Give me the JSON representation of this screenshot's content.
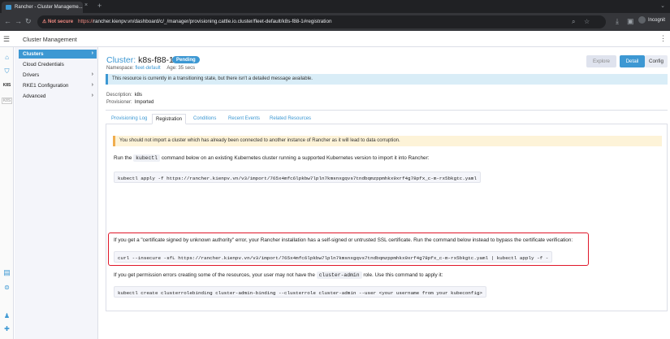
{
  "browser": {
    "tab_title": "Rancher - Cluster Manageme...",
    "tab_close": "×",
    "new_tab": "+",
    "tab_menu": "⌄",
    "not_secure": "Not secure",
    "url_scheme": "https://",
    "url_rest": "rancher.kienpv.vn/dashboard/c/_/manager/provisioning.cattle.io.cluster/fleet-default/k8s-f88-1#registration",
    "profile_label": "Incognit",
    "icons": [
      "back-arrow-icon",
      "forward-arrow-icon",
      "reload-icon",
      "zoom-icon",
      "star-icon",
      "download-icon"
    ]
  },
  "header": {
    "title": "Cluster Management"
  },
  "rail": {
    "k8s_label": "K8S",
    "k8s_dim_label": "K8S"
  },
  "sidebar": {
    "items": [
      {
        "label": "Clusters",
        "active": true,
        "chevron": "›"
      },
      {
        "label": "Cloud Credentials",
        "active": false,
        "chevron": ""
      },
      {
        "label": "Drivers",
        "active": false,
        "chevron": "›"
      },
      {
        "label": "RKE1 Configuration",
        "active": false,
        "chevron": "›"
      },
      {
        "label": "Advanced",
        "active": false,
        "chevron": "›"
      }
    ]
  },
  "cluster": {
    "label": "Cluster:",
    "name": "k8s-f88-1",
    "status": "Pending",
    "namespace_label": "Namespace:",
    "namespace": "fleet-default",
    "age": "Age: 35 secs",
    "buttons": {
      "explore": "Explore",
      "detail": "Detail",
      "config": "Config"
    },
    "transition_message": "This resource is currently in a transitioning state, but there isn't a detailed message available.",
    "description_label": "Description:",
    "description": "k8s",
    "provisioner_label": "Provisioner:",
    "provisioner": "Imported"
  },
  "tabs": [
    {
      "label": "Provisioning Log",
      "active": false
    },
    {
      "label": "Registration",
      "active": true
    },
    {
      "label": "Conditions",
      "active": false
    },
    {
      "label": "Recent Events",
      "active": false
    },
    {
      "label": "Related Resources",
      "active": false
    }
  ],
  "registration": {
    "warning": "You should not import a cluster which has already been connected to another instance of Rancher as it will lead to data corruption.",
    "run_prefix": "Run the",
    "run_kw": "kubectl",
    "run_suffix": "command below on an existing Kubernetes cluster running a supported Kubernetes version to import it into Rancher:",
    "cmd_apply": "kubectl apply -f https://rancher.kienpv.vn/v3/import/765x4mfc6lpkbw7lpln7kmsnxgqvs7tndbqmzppmhkx9xrf4g78pfx_c-m-rx5bkgtc.yaml",
    "cert_note": "If you get a \"certificate signed by unknown authority\" error, your Rancher installation has a self-signed or untrusted SSL certificate. Run the command below instead to bypass the certificate verification:",
    "cmd_insecure": "curl --insecure -sfL https://rancher.kienpv.vn/v3/import/765x4mfc6lpkbw7lpln7kmsnxgqvs7tndbqmzppmhkx9xrf4g78pfx_c-m-rx5bkgtc.yaml | kubectl apply -f -",
    "perm_prefix": "If you get permission errors creating some of the resources, your user may not have the",
    "perm_kw": "cluster-admin",
    "perm_suffix": "role. Use this command to apply it:",
    "cmd_binding": "kubectl create clusterrolebinding cluster-admin-binding --clusterrole cluster-admin --user <your username from your kubeconfig>"
  },
  "colors": {
    "accent": "#3d98d3",
    "highlight": "#e0182a",
    "warning": "#f0ad4e"
  }
}
